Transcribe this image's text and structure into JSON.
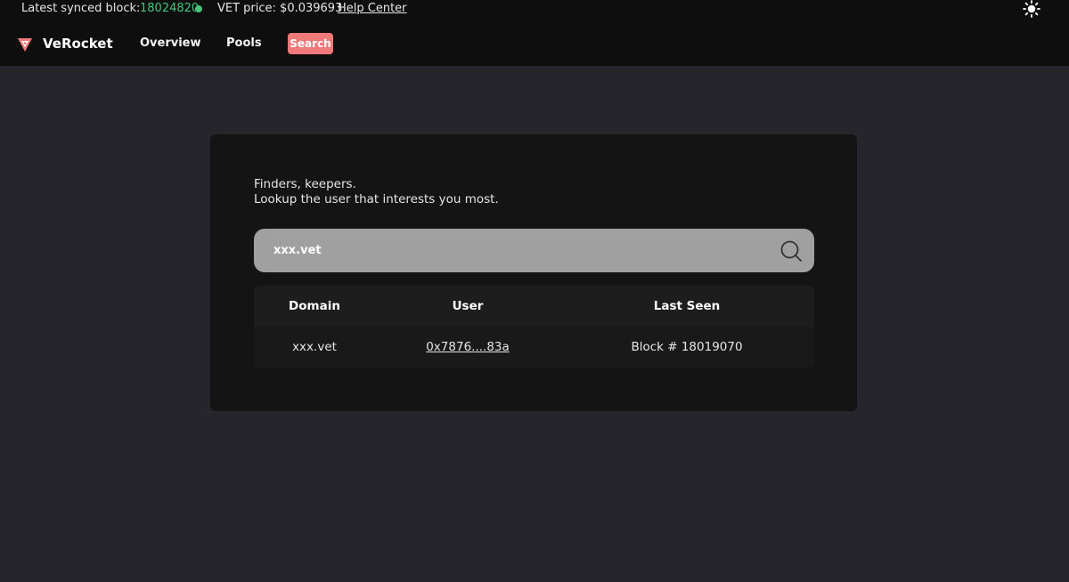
{
  "status_bar": {
    "synced_label": "Latest synced block:",
    "synced_block": "18024820",
    "vet_price": "VET price: $0.039693",
    "help_center": "Help Center",
    "status_color": "#43c77a",
    "theme_icon": "sun-icon"
  },
  "nav": {
    "brand": "VeRocket",
    "logo_icon": "verocket-logo-icon",
    "items": [
      {
        "label": "Overview"
      },
      {
        "label": "Pools"
      },
      {
        "label": "Search"
      }
    ],
    "active_item": "Search",
    "accent_color": "#f07a7a"
  },
  "search_panel": {
    "intro_line_1": "Finders, keepers.",
    "intro_line_2": "Lookup the user that interests you most.",
    "query": "xxx.vet",
    "search_icon": "search-icon"
  },
  "results": {
    "columns": [
      "Domain",
      "User",
      "Last Seen"
    ],
    "rows": [
      {
        "domain": "xxx.vet",
        "user": "0x7876....83a",
        "last_seen": "Block # 18019070"
      }
    ]
  }
}
